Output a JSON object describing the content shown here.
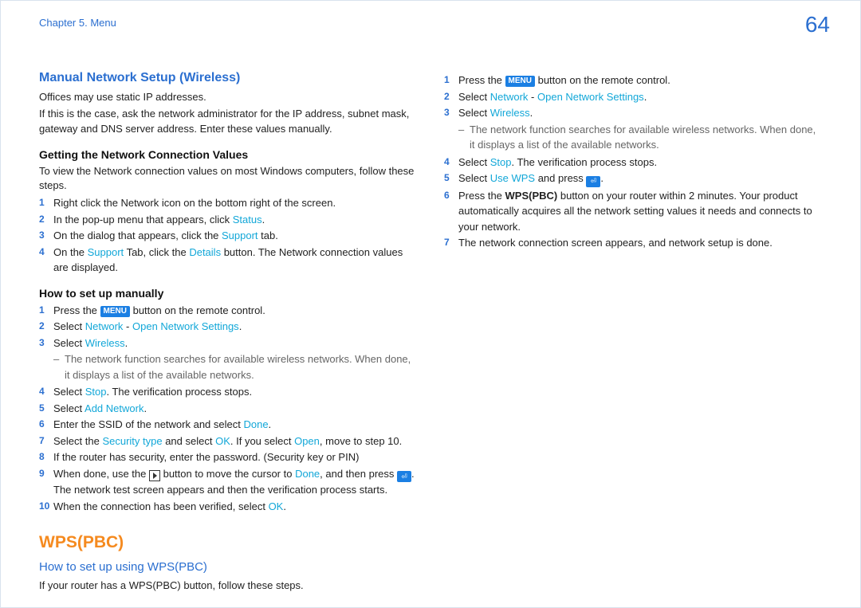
{
  "header": {
    "chapter": "Chapter 5. Menu",
    "page": "64"
  },
  "left": {
    "title1": "Manual Network Setup (Wireless)",
    "p1": "Offices may use static IP addresses.",
    "p2": "If this is the case, ask the network administrator for the IP address, subnet mask, gateway and DNS server address. Enter these values manually.",
    "sub1": "Getting the Network Connection Values",
    "p3": "To view the Network connection values on most Windows computers, follow these steps.",
    "nc": {
      "s1": "Right click the Network icon on the bottom right of the screen.",
      "s2a": "In the pop-up menu that appears, click ",
      "s2b": "Status",
      "s2c": ".",
      "s3a": "On the dialog that appears, click the ",
      "s3b": "Support",
      "s3c": " tab.",
      "s4a": "On the ",
      "s4b": "Support",
      "s4c": " Tab, click the ",
      "s4d": "Details",
      "s4e": " button. The Network connection values are displayed."
    },
    "sub2": "How to set up manually",
    "man": {
      "s1a": "Press the ",
      "s1menu": "MENU",
      "s1b": " button on the remote control.",
      "s2a": "Select ",
      "s2b": "Network",
      "s2c": " - ",
      "s2d": "Open Network Settings",
      "s2e": ".",
      "s3a": "Select ",
      "s3b": "Wireless",
      "s3c": ".",
      "note": "The network function searches for available wireless networks. When done, it displays a list of the available networks.",
      "s4a": "Select ",
      "s4b": "Stop",
      "s4c": ". The verification process stops.",
      "s5a": "Select ",
      "s5b": "Add Network",
      "s5c": ".",
      "s6a": "Enter the SSID of the network and select ",
      "s6b": "Done",
      "s6c": ".",
      "s7a": "Select the ",
      "s7b": "Security type",
      "s7c": " and select ",
      "s7d": "OK",
      "s7e": ". If you select ",
      "s7f": "Open",
      "s7g": ", move to step 10.",
      "s8": "If the router has security, enter the password. (Security key or PIN)",
      "s9a": "When done, use the ",
      "s9b": " button to move the cursor to ",
      "s9c": "Done",
      "s9d": ", and then press ",
      "s9e": ". The network test screen appears and then the verification process starts.",
      "s10a": "When the connection has been verified, select ",
      "s10b": "OK",
      "s10c": "."
    },
    "wps_title": "WPS(PBC)",
    "wps_sub": "How to set up using WPS(PBC)",
    "wps_intro": "If your router has a WPS(PBC) button, follow these steps."
  },
  "right": {
    "s1a": "Press the ",
    "s1menu": "MENU",
    "s1b": " button on the remote control.",
    "s2a": "Select ",
    "s2b": "Network",
    "s2c": " - ",
    "s2d": "Open Network Settings",
    "s2e": ".",
    "s3a": "Select ",
    "s3b": "Wireless",
    "s3c": ".",
    "note": "The network function searches for available wireless networks. When done, it displays a list of the available networks.",
    "s4a": "Select ",
    "s4b": "Stop",
    "s4c": ". The verification process stops.",
    "s5a": "Select ",
    "s5b": "Use WPS",
    "s5c": " and press ",
    "s5d": ".",
    "s6a": "Press the ",
    "s6b": "WPS(PBC)",
    "s6c": " button on your router within 2 minutes. Your product automatically acquires all the network setting values it needs and connects to your network.",
    "s7": "The network connection screen appears, and network setup is done."
  }
}
